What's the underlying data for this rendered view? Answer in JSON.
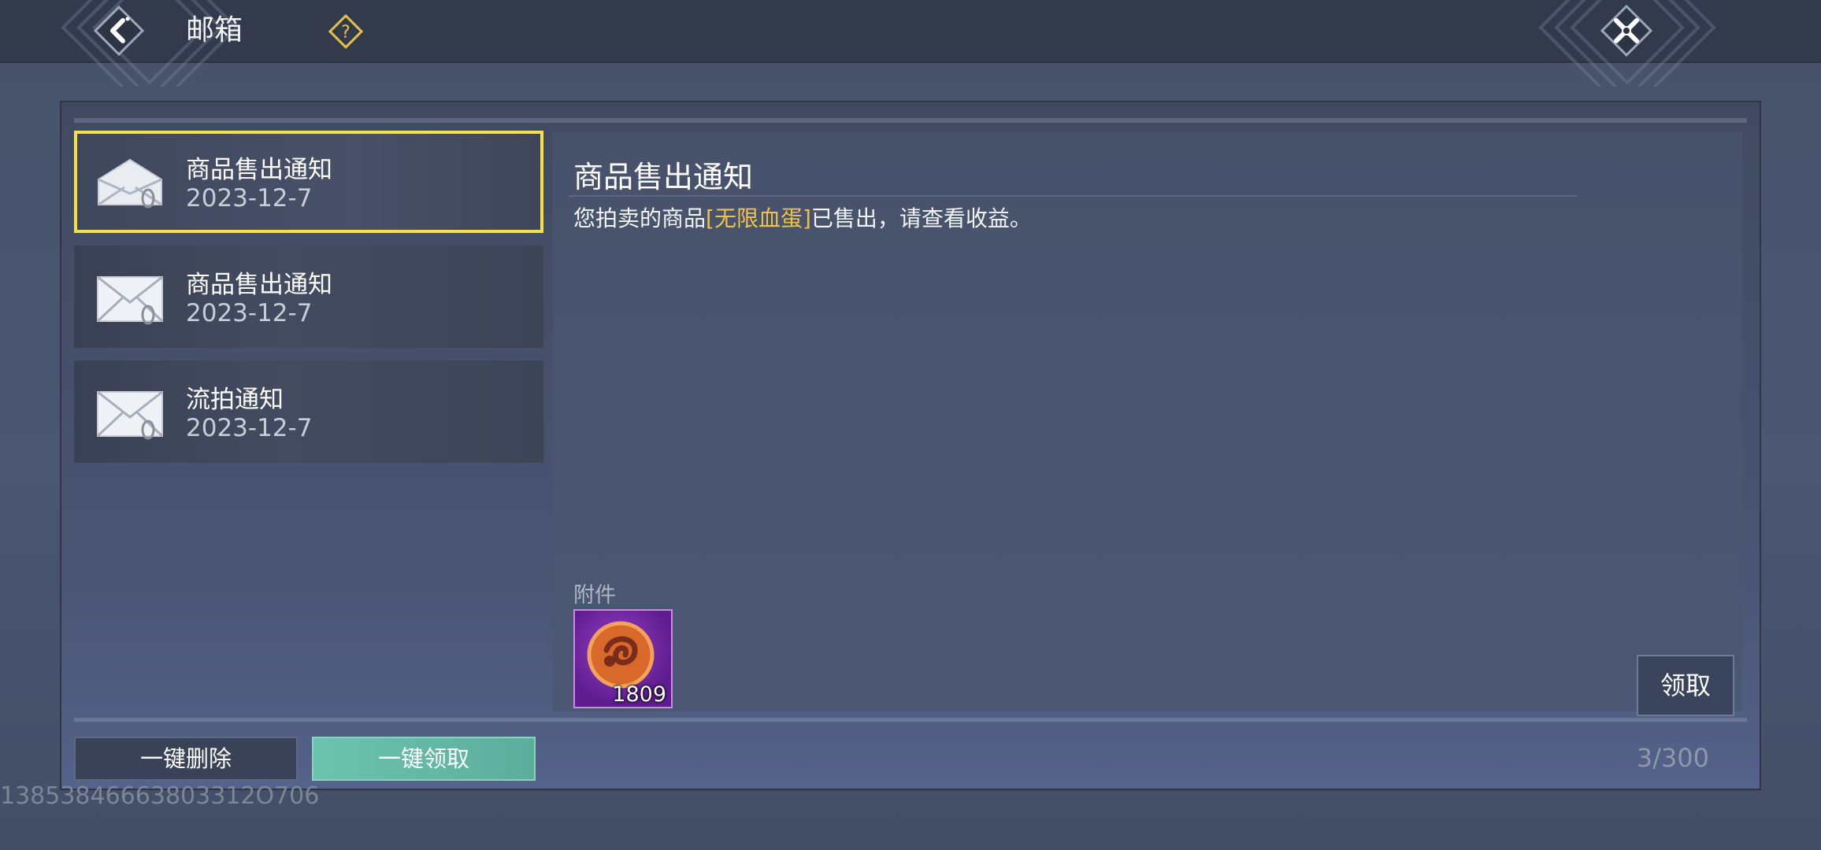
{
  "header": {
    "title": "邮箱",
    "back_icon": "chevron-left-icon",
    "help_icon": "question-icon",
    "close_icon": "close-x-icon"
  },
  "mail_list": [
    {
      "subject": "商品售出通知",
      "date": "2023-12-7",
      "selected": true
    },
    {
      "subject": "商品售出通知",
      "date": "2023-12-7",
      "selected": false
    },
    {
      "subject": "流拍通知",
      "date": "2023-12-7",
      "selected": false
    }
  ],
  "detail": {
    "title": "商品售出通知",
    "body_prefix": "您拍卖的商品",
    "body_highlight": "[无限血蛋]",
    "body_suffix": "已售出，请查看收益。",
    "attachment_label": "附件",
    "attachment": {
      "icon": "currency-coin-icon",
      "quantity": "1809"
    },
    "claim_label": "领取"
  },
  "footer": {
    "delete_all_label": "一键删除",
    "claim_all_label": "一键领取",
    "mail_count": "3/300"
  },
  "uid": "13853846663803312O706",
  "colors": {
    "selected_border": "#f3e04a",
    "highlight": "#f0c248",
    "claim_all_bg": "#6cc3ad"
  }
}
